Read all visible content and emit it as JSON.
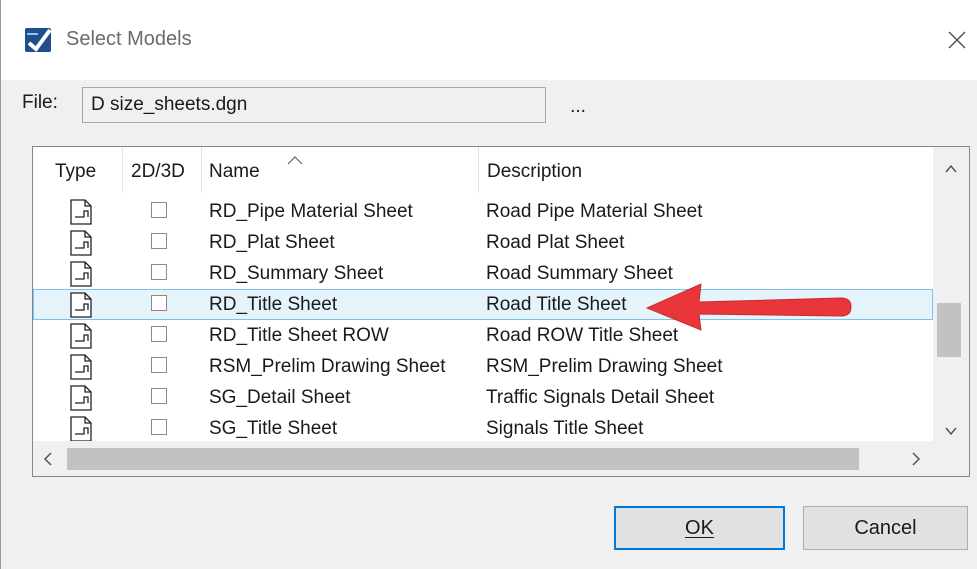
{
  "window": {
    "title": "Select Models"
  },
  "file": {
    "label": "File:",
    "value": "D size_sheets.dgn",
    "browse_label": "..."
  },
  "columns": {
    "type": "Type",
    "dim": "2D/3D",
    "name": "Name",
    "description": "Description"
  },
  "rows": [
    {
      "name": "RD_Pipe Material Sheet",
      "description": "Road Pipe Material Sheet"
    },
    {
      "name": "RD_Plat Sheet",
      "description": "Road Plat Sheet"
    },
    {
      "name": "RD_Summary Sheet",
      "description": "Road Summary Sheet"
    },
    {
      "name": "RD_Title Sheet",
      "description": "Road Title Sheet",
      "selected": true
    },
    {
      "name": "RD_Title Sheet ROW",
      "description": "Road ROW Title Sheet"
    },
    {
      "name": "RSM_Prelim Drawing Sheet",
      "description": "RSM_Prelim Drawing Sheet"
    },
    {
      "name": "SG_Detail Sheet",
      "description": "Traffic Signals Detail Sheet"
    },
    {
      "name": "SG_Title Sheet",
      "description": "Signals Title Sheet"
    }
  ],
  "buttons": {
    "ok": "OK",
    "cancel": "Cancel"
  },
  "icons": {
    "app": "microstation-logo-icon",
    "close": "close-icon",
    "type": "sheet-model-icon",
    "sort": "sort-ascending-icon"
  },
  "colors": {
    "selection_bg": "#e5f3fb",
    "selection_border": "#7fc1e8",
    "annotation_arrow": "#e8363a",
    "default_button_border": "#0078d7"
  }
}
